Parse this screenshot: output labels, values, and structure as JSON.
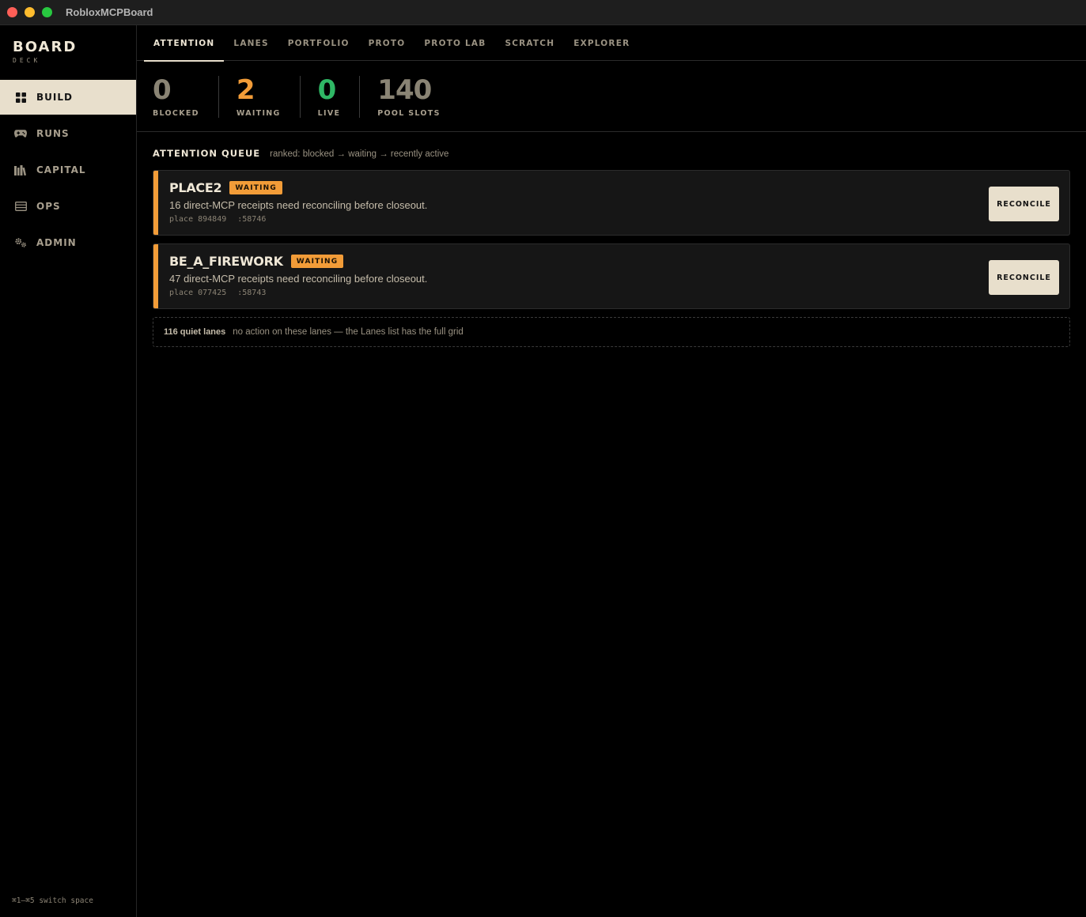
{
  "window": {
    "title": "RobloxMCPBoard"
  },
  "brand": {
    "title": "BOARD",
    "subtitle": "DECK"
  },
  "sidebar": {
    "items": [
      {
        "label": "BUILD",
        "icon": "grid-icon",
        "active": true
      },
      {
        "label": "RUNS",
        "icon": "gamepad-icon",
        "active": false
      },
      {
        "label": "CAPITAL",
        "icon": "library-icon",
        "active": false
      },
      {
        "label": "OPS",
        "icon": "list-icon",
        "active": false
      },
      {
        "label": "ADMIN",
        "icon": "gears-icon",
        "active": false
      }
    ],
    "hint": "⌘1–⌘5 switch space"
  },
  "tabs": [
    {
      "label": "ATTENTION",
      "active": true
    },
    {
      "label": "LANES",
      "active": false
    },
    {
      "label": "PORTFOLIO",
      "active": false
    },
    {
      "label": "PROTO",
      "active": false
    },
    {
      "label": "PROTO LAB",
      "active": false
    },
    {
      "label": "SCRATCH",
      "active": false
    },
    {
      "label": "EXPLORER",
      "active": false
    }
  ],
  "stats": [
    {
      "value": "0",
      "label": "BLOCKED",
      "color": "#8a8474"
    },
    {
      "value": "2",
      "label": "WAITING",
      "color": "#f29c38"
    },
    {
      "value": "0",
      "label": "LIVE",
      "color": "#2fb765"
    },
    {
      "value": "140",
      "label": "POOL SLOTS",
      "color": "#8a8474"
    }
  ],
  "queue": {
    "title": "ATTENTION QUEUE",
    "subtitle": "ranked: blocked → waiting → recently active",
    "cards": [
      {
        "name": "PLACE2",
        "badge": "WAITING",
        "description": "16 direct-MCP receipts need reconciling before closeout.",
        "place": "place 894849",
        "port": ":58746",
        "action": "RECONCILE"
      },
      {
        "name": "BE_A_FIREWORK",
        "badge": "WAITING",
        "description": "47 direct-MCP receipts need reconciling before closeout.",
        "place": "place 077425",
        "port": ":58743",
        "action": "RECONCILE"
      }
    ],
    "quiet": {
      "count": "116 quiet lanes",
      "text": "no action on these lanes — the Lanes list has the full grid"
    }
  },
  "colors": {
    "accent": "#f29c38",
    "live": "#2fb765",
    "cream": "#e8dfcc"
  }
}
